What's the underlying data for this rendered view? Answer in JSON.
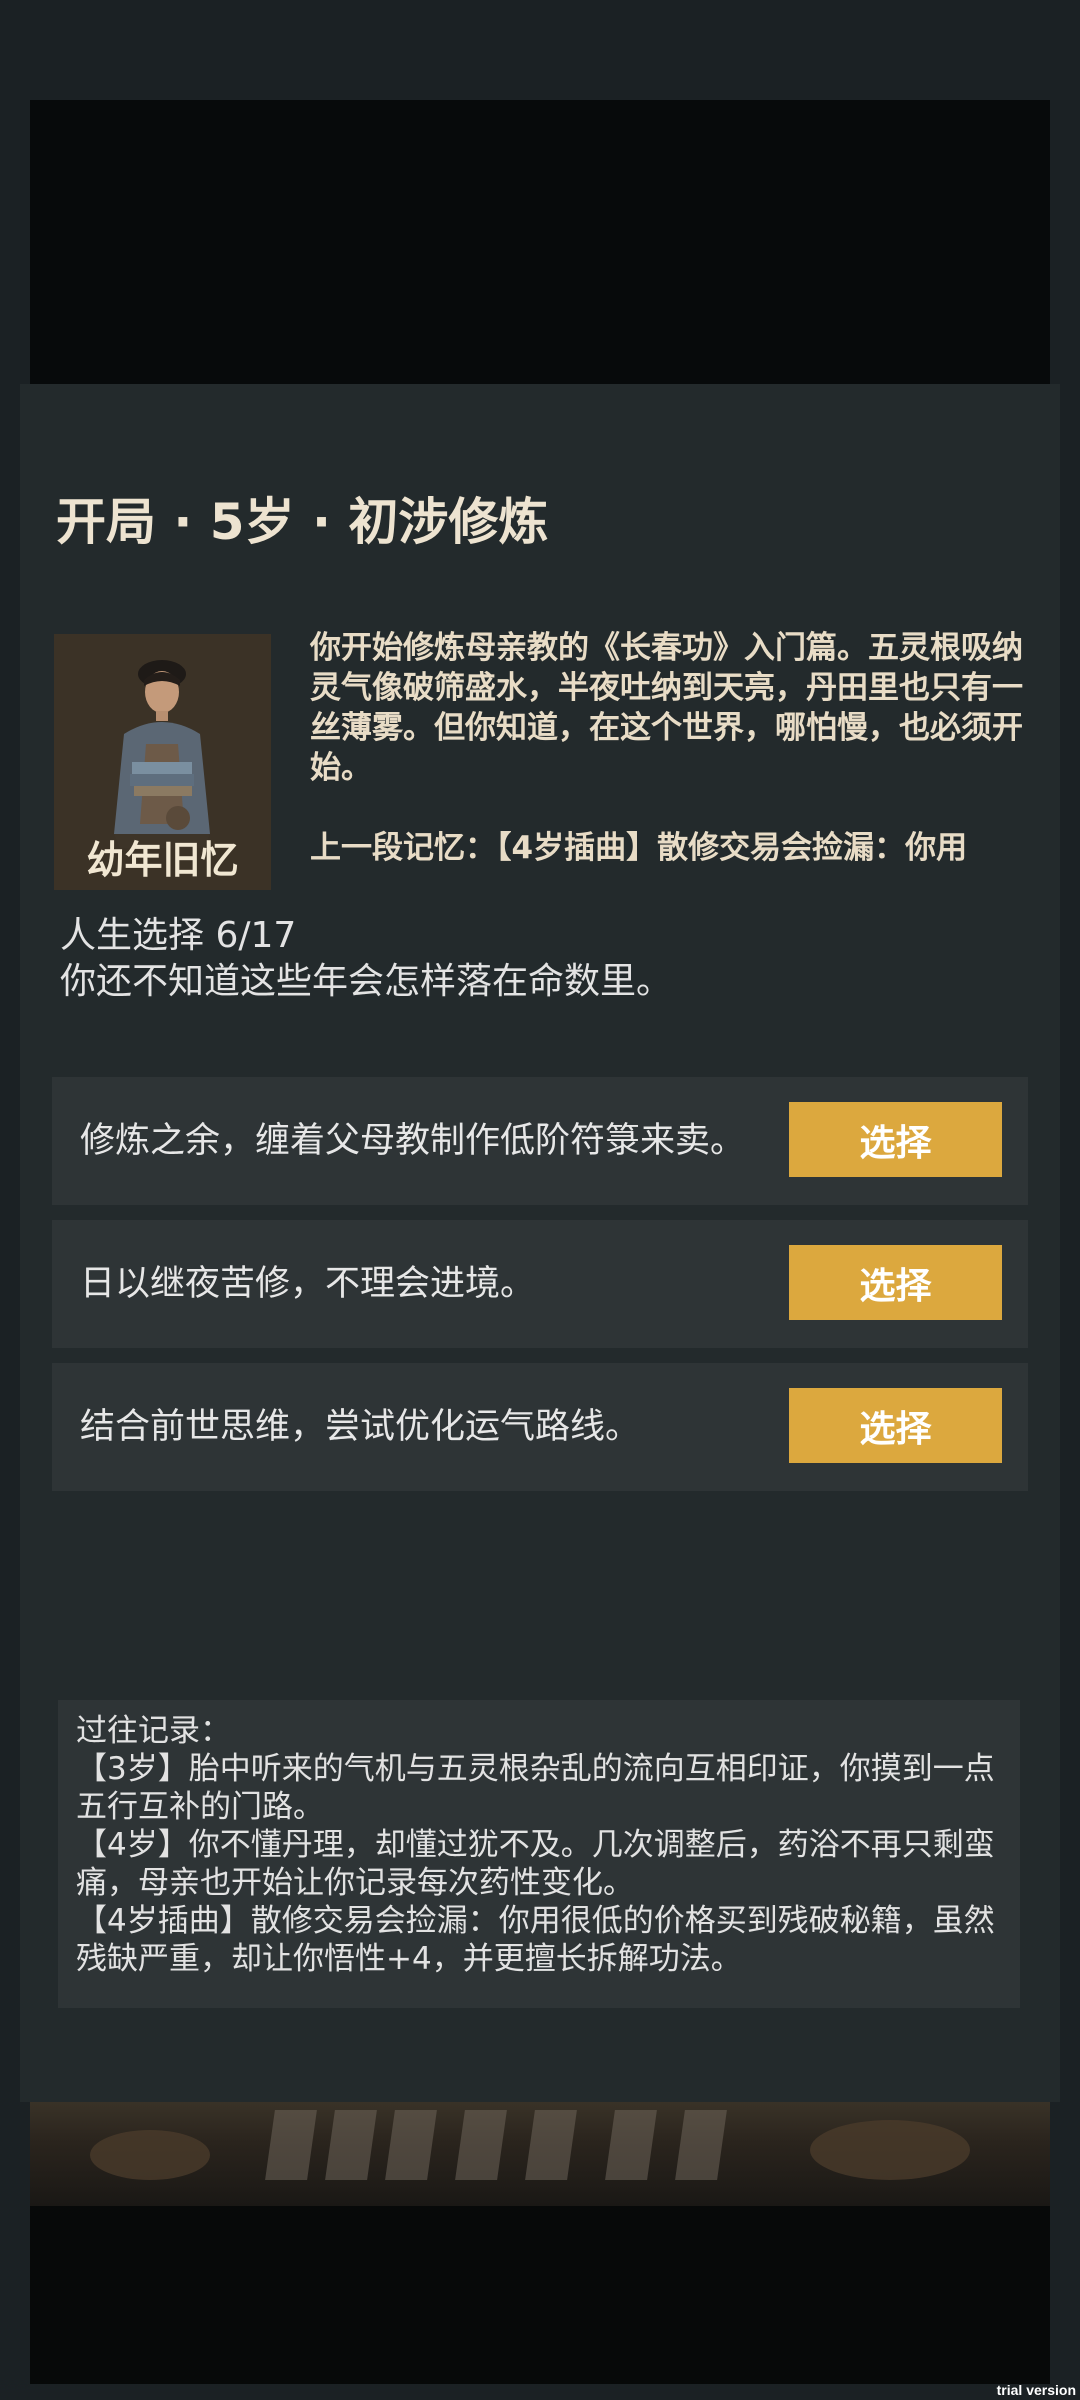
{
  "header": {
    "title": "开局 · 5岁 · 初涉修炼"
  },
  "event": {
    "portrait_caption": "幼年旧忆",
    "story": "你开始修炼母亲教的《长春功》入门篇。五灵根吸纳灵气像破筛盛水，半夜吐纳到天亮，丹田里也只有一丝薄雾。但你知道，在这个世界，哪怕慢，也必须开始。",
    "memory": "上一段记忆：【4岁插曲】散修交易会捡漏：你用"
  },
  "choices_info": {
    "count_label": "人生选择 6/17",
    "hint": "你还不知道这些年会怎样落在命数里。"
  },
  "choices": [
    {
      "text": "修炼之余，缠着父母教制作低阶符箓来卖。",
      "button": "选择"
    },
    {
      "text": "日以继夜苦修，不理会进境。",
      "button": "选择"
    },
    {
      "text": "结合前世思维，尝试优化运气路线。",
      "button": "选择"
    }
  ],
  "log": {
    "lines": [
      "过往记录：",
      "【3岁】胎中听来的气机与五灵根杂乱的流向互相印证，你摸到一点五行互补的门路。",
      "【4岁】你不懂丹理，却懂过犹不及。几次调整后，药浴不再只剩蛮痛，母亲也开始让你记录每次药性变化。",
      "【4岁插曲】散修交易会捡漏：你用很低的价格买到残破秘籍，虽然残缺严重，却让你悟性+4，并更擅长拆解功法。"
    ]
  },
  "watermark": "trial version",
  "colors": {
    "accent": "#dca83e",
    "panel": "#232a2c",
    "row": "#2e3436"
  }
}
